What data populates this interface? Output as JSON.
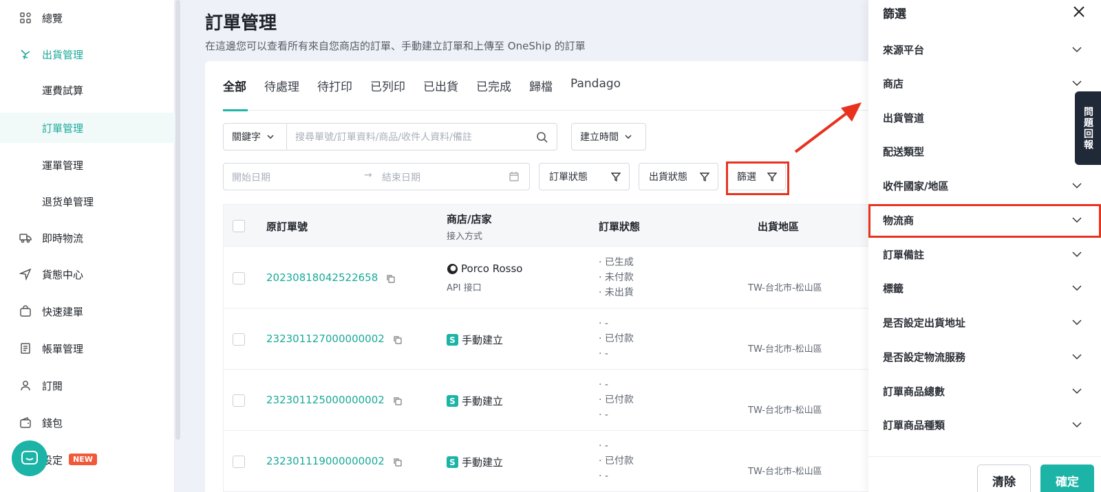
{
  "sidebar": {
    "items": [
      {
        "label": "總覽",
        "icon": "grid-icon"
      },
      {
        "label": "出貨管理",
        "icon": "shipping-icon"
      },
      {
        "label": "運費試算",
        "icon": ""
      },
      {
        "label": "訂單管理",
        "icon": ""
      },
      {
        "label": "運單管理",
        "icon": ""
      },
      {
        "label": "退货单管理",
        "icon": ""
      },
      {
        "label": "即時物流",
        "icon": "truck-icon"
      },
      {
        "label": "貨態中心",
        "icon": "navigation-icon"
      },
      {
        "label": "快速建單",
        "icon": "bag-icon"
      },
      {
        "label": "帳單管理",
        "icon": "bill-icon"
      },
      {
        "label": "訂閱",
        "icon": "user-icon"
      },
      {
        "label": "錢包",
        "icon": "wallet-icon"
      },
      {
        "label": "設定",
        "icon": "settings-icon"
      }
    ],
    "new_badge": "NEW"
  },
  "header": {
    "title": "訂單管理",
    "description": "在這邊您可以查看所有來自您商店的訂單、手動建立訂單和上傳至 OneShip 的訂單"
  },
  "tabs": [
    "全部",
    "待處理",
    "待打印",
    "已列印",
    "已出貨",
    "已完成",
    "歸檔",
    "Pandago"
  ],
  "filters": {
    "keyword_label": "關鍵字",
    "search_placeholder": "搜尋單號/訂單資料/商品/收件人資料/備註",
    "created_time": "建立時間",
    "start_date": "開始日期",
    "end_date": "結束日期",
    "order_status": "訂單狀態",
    "shipping_status": "出貨狀態",
    "filter": "篩選"
  },
  "table": {
    "headers": {
      "order_no": "原訂單號",
      "shop": "商店/店家",
      "shop_sub": "接入方式",
      "status": "訂單狀態",
      "region": "出貨地區"
    },
    "rows": [
      {
        "order_no": "20230818042522658",
        "shop": "Porco Rosso",
        "shop_sub": "API 接口",
        "status": [
          "· 已生成",
          "· 未付款",
          "· 未出貨"
        ],
        "region": "TW-台北市-松山區"
      },
      {
        "order_no": "232301127000000002",
        "shop": "手動建立",
        "shop_sub": "",
        "status": [
          "· -",
          "· 已付款",
          "· -"
        ],
        "region": "TW-台北市-松山區"
      },
      {
        "order_no": "232301125000000002",
        "shop": "手動建立",
        "shop_sub": "",
        "status": [
          "· -",
          "· 已付款",
          "· -"
        ],
        "region": "TW-台北市-松山區"
      },
      {
        "order_no": "232301119000000002",
        "shop": "手動建立",
        "shop_sub": "",
        "status": [
          "· -",
          "· 已付款",
          "· -"
        ],
        "region": "TW-台北市-松山區"
      }
    ]
  },
  "panel": {
    "title": "篩選",
    "items": [
      "來源平台",
      "商店",
      "出貨管道",
      "配送類型",
      "收件國家/地區",
      "物流商",
      "訂單備註",
      "標籤",
      "是否設定出貨地址",
      "是否設定物流服務",
      "訂單商品總數",
      "訂單商品種類"
    ],
    "clear": "清除",
    "confirm": "確定"
  },
  "feedback": "問題回報",
  "colors": {
    "accent": "#1bb4a6",
    "highlight": "#e8321e"
  }
}
